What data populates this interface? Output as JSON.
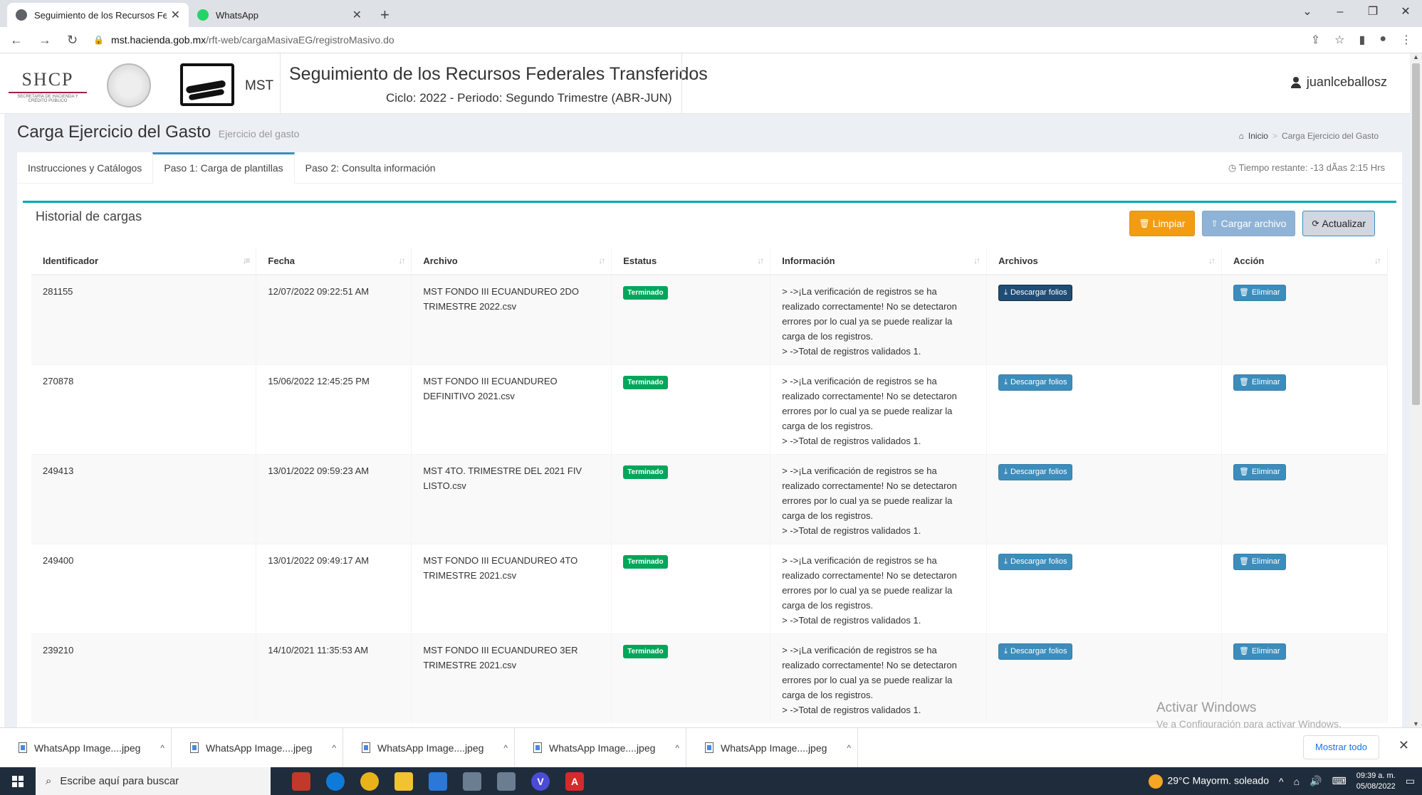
{
  "browser": {
    "tabs": [
      {
        "title": "Seguimiento de los Recursos Fe",
        "close": "✕",
        "active": true
      },
      {
        "title": "WhatsApp",
        "close": "✕",
        "active": false
      }
    ],
    "new_tab": "+",
    "url_host": "mst.hacienda.gob.mx",
    "url_path": "/rft-web/cargaMasivaEG/registroMasivo.do"
  },
  "header": {
    "shcp_big": "SHCP",
    "shcp_small": "SECRETARÍA DE HACIENDA Y CRÉDITO PÚBLICO",
    "mst_label": "MST",
    "title": "Seguimiento de los Recursos Federales Transferidos",
    "cycle": "Ciclo: 2022 - Periodo: Segundo Trimestre (ABR-JUN)",
    "user": "juanlceballosz"
  },
  "page": {
    "title": "Carga Ejercicio del Gasto",
    "subtitle": "Ejercicio del gasto",
    "breadcrumb_home": "Inicio",
    "breadcrumb_current": "Carga Ejercicio del Gasto"
  },
  "tabs": [
    {
      "label": "Instrucciones y Catálogos"
    },
    {
      "label": "Paso 1: Carga de plantillas"
    },
    {
      "label": "Paso 2: Consulta información"
    }
  ],
  "timer": "Tiempo restante: -13 dÃas 2:15 Hrs",
  "panel": {
    "title": "Historial de cargas",
    "btn_limpiar": "Limpiar",
    "btn_cargar": "Cargar archivo",
    "btn_actualizar": "Actualizar"
  },
  "table": {
    "headers": [
      "Identificador",
      "Fecha",
      "Archivo",
      "Estatus",
      "Información",
      "Archivos",
      "Acción"
    ],
    "download_label": "Descargar folios",
    "delete_label": "Eliminar",
    "rows": [
      {
        "id": "281155",
        "date": "12/07/2022 09:22:51 AM",
        "file": "MST FONDO III ECUANDUREO 2DO TRIMESTRE 2022.csv",
        "status": "Terminado",
        "info1": "> ->¡La verificación de registros se ha realizado correctamente! No se detectaron errores por lo cual ya se puede realizar la carga de los registros.",
        "info2": "> ->Total de registros validados 1."
      },
      {
        "id": "270878",
        "date": "15/06/2022 12:45:25 PM",
        "file": "MST FONDO III ECUANDUREO DEFINITIVO 2021.csv",
        "status": "Terminado",
        "info1": "> ->¡La verificación de registros se ha realizado correctamente! No se detectaron errores por lo cual ya se puede realizar la carga de los registros.",
        "info2": "> ->Total de registros validados 1."
      },
      {
        "id": "249413",
        "date": "13/01/2022 09:59:23 AM",
        "file": "MST 4TO. TRIMESTRE DEL 2021 FIV LISTO.csv",
        "status": "Terminado",
        "info1": "> ->¡La verificación de registros se ha realizado correctamente! No se detectaron errores por lo cual ya se puede realizar la carga de los registros.",
        "info2": "> ->Total de registros validados 1."
      },
      {
        "id": "249400",
        "date": "13/01/2022 09:49:17 AM",
        "file": "MST FONDO III ECUANDUREO 4TO TRIMESTRE 2021.csv",
        "status": "Terminado",
        "info1": "> ->¡La verificación de registros se ha realizado correctamente! No se detectaron errores por lo cual ya se puede realizar la carga de los registros.",
        "info2": "> ->Total de registros validados 1."
      },
      {
        "id": "239210",
        "date": "14/10/2021 11:35:53 AM",
        "file": "MST FONDO III ECUANDUREO 3ER TRIMESTRE 2021.csv",
        "status": "Terminado",
        "info1": "> ->¡La verificación de registros se ha realizado correctamente! No se detectaron errores por lo cual ya se puede realizar la carga de los registros.",
        "info2": "> ->Total de registros validados 1."
      }
    ]
  },
  "watermark": {
    "line1": "Activar Windows",
    "line2": "Ve a Configuración para activar Windows."
  },
  "downloads": {
    "items": [
      "WhatsApp Image....jpeg",
      "WhatsApp Image....jpeg",
      "WhatsApp Image....jpeg",
      "WhatsApp Image....jpeg",
      "WhatsApp Image....jpeg"
    ],
    "show_all": "Mostrar todo"
  },
  "taskbar": {
    "search_placeholder": "Escribe aquí para buscar",
    "weather": "29°C  Mayorm. soleado",
    "time": "09:39 a. m.",
    "date": "05/08/2022"
  },
  "colors": {
    "accent": "#3c8dbc",
    "teal_bar": "#00a7b8",
    "success": "#00a65a",
    "warning": "#f39c12"
  }
}
